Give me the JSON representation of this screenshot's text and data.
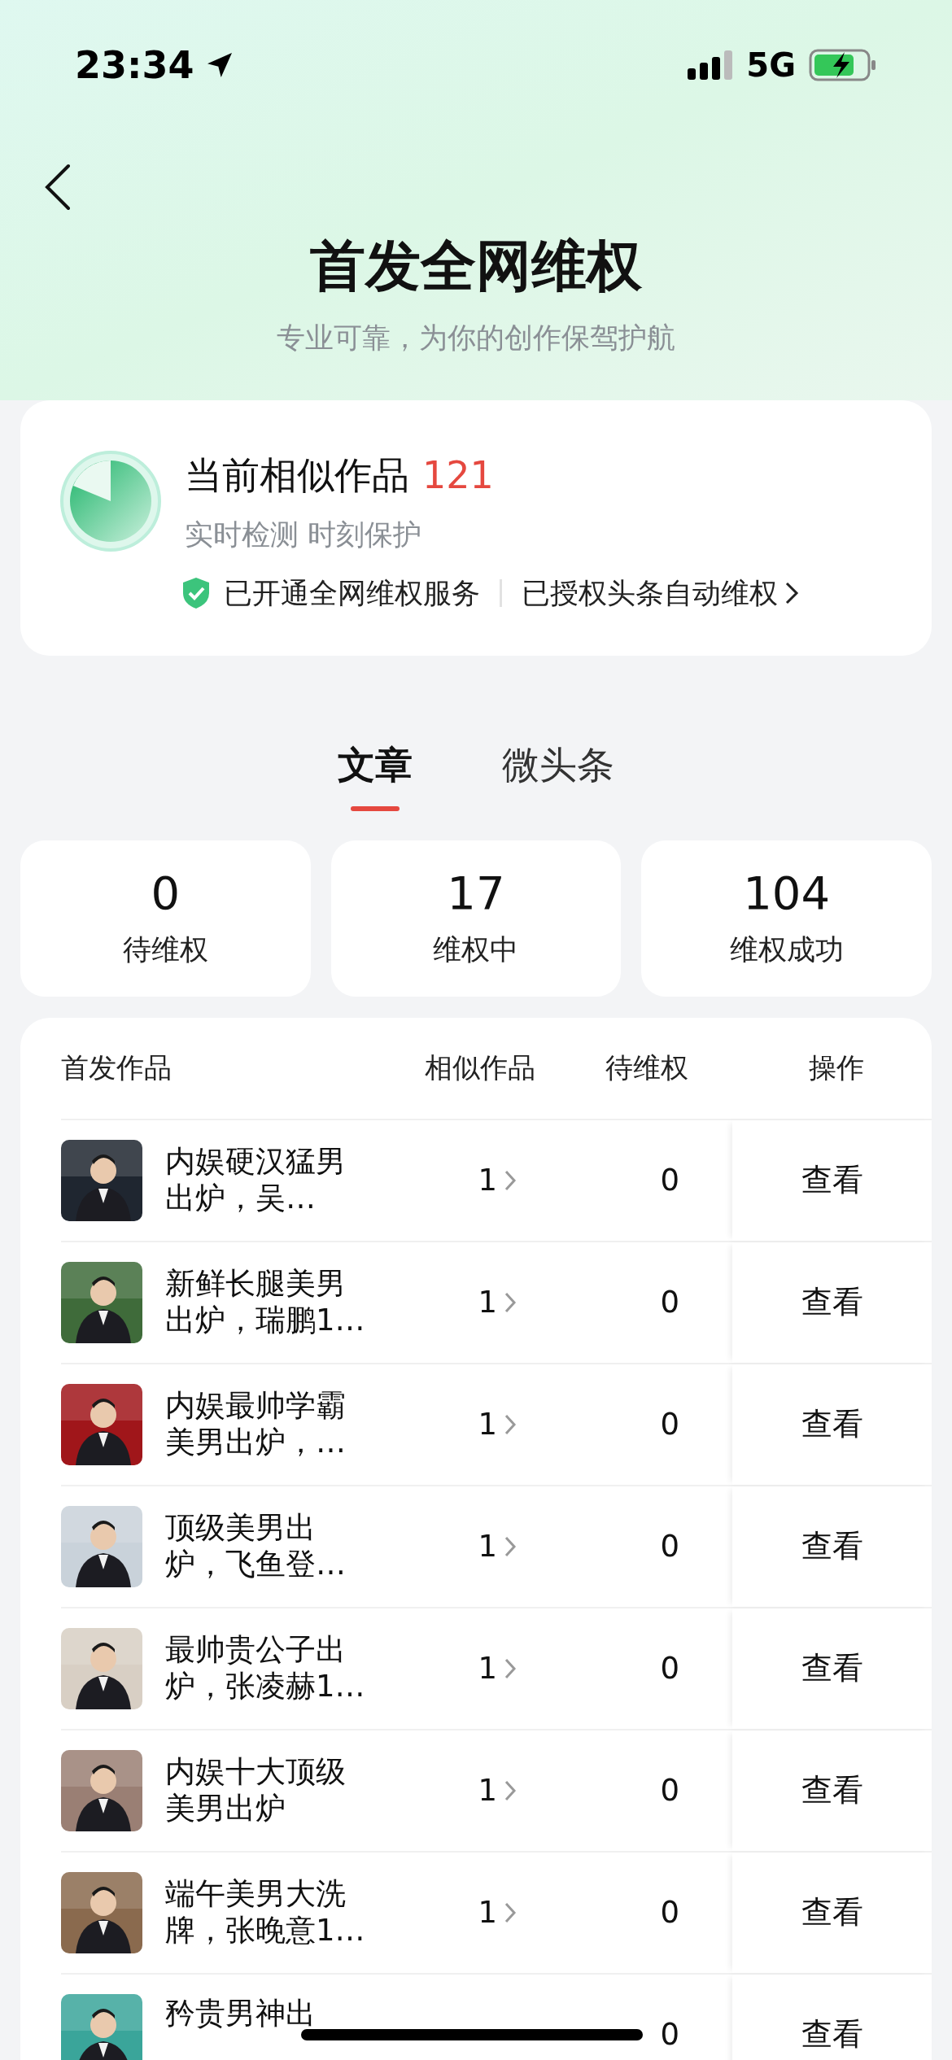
{
  "status_bar": {
    "time": "23:34",
    "network": "5G"
  },
  "header": {
    "title": "首发全网维权",
    "subtitle": "专业可靠，为你的创作保驾护航"
  },
  "summary": {
    "label": "当前相似作品",
    "count": "121",
    "caption": "实时检测 时刻保护",
    "service": "已开通全网维权服务",
    "authorized": "已授权头条自动维权"
  },
  "tabs": [
    {
      "label": "文章",
      "selected": true
    },
    {
      "label": "微头条",
      "selected": false
    }
  ],
  "stats": [
    {
      "value": "0",
      "label": "待维权"
    },
    {
      "value": "17",
      "label": "维权中"
    },
    {
      "value": "104",
      "label": "维权成功"
    }
  ],
  "table": {
    "columns": [
      "首发作品",
      "相似作品",
      "待维权",
      "操作"
    ],
    "rows": [
      {
        "title_lines": [
          "内娱硬汉猛男",
          "出炉，吴…"
        ],
        "similar": "1",
        "pending": "0",
        "action": "查看",
        "thumb": {
          "kind": "picture"
        }
      },
      {
        "title_lines": [
          "新鲜长腿美男",
          "出炉，瑞鹏1…"
        ],
        "similar": "1",
        "pending": "0",
        "action": "查看",
        "thumb": {
          "kind": "picture"
        }
      },
      {
        "title_lines": [
          "内娱最帅学霸",
          "美男出炉，…"
        ],
        "similar": "1",
        "pending": "0",
        "action": "查看",
        "thumb": {
          "kind": "picture"
        }
      },
      {
        "title_lines": [
          "顶级美男出",
          "炉，飞鱼登…"
        ],
        "similar": "1",
        "pending": "0",
        "action": "查看",
        "thumb": {
          "kind": "picture"
        }
      },
      {
        "title_lines": [
          "最帅贵公子出",
          "炉，张凌赫1…"
        ],
        "similar": "1",
        "pending": "0",
        "action": "查看",
        "thumb": {
          "kind": "picture"
        }
      },
      {
        "title_lines": [
          "内娱十大顶级",
          "美男出炉"
        ],
        "similar": "1",
        "pending": "0",
        "action": "查看",
        "thumb": {
          "kind": "picture"
        }
      },
      {
        "title_lines": [
          "端午美男大洗",
          "牌，张晚意1…"
        ],
        "similar": "1",
        "pending": "0",
        "action": "查看",
        "thumb": {
          "kind": "picture"
        }
      },
      {
        "title_lines": [
          "矜贵男神出"
        ],
        "pending": "0",
        "action": "查看",
        "thumb": {
          "kind": "picture"
        }
      }
    ]
  }
}
